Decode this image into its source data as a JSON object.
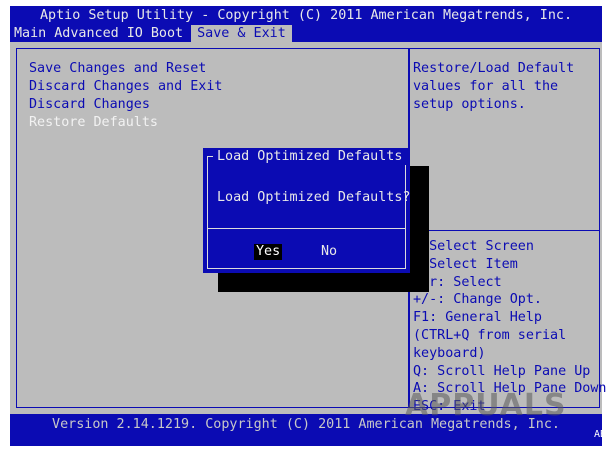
{
  "header": {
    "title": "Aptio Setup Utility - Copyright (C) 2011 American Megatrends, Inc.",
    "tabs": [
      {
        "label": "Main"
      },
      {
        "label": "Advanced"
      },
      {
        "label": "IO"
      },
      {
        "label": "Boot"
      },
      {
        "label": "Save & Exit"
      }
    ],
    "active_tab": "Save & Exit"
  },
  "menu": {
    "items": [
      {
        "label": "Save Changes and Reset"
      },
      {
        "label": "Discard Changes and Exit"
      },
      {
        "label": "Discard Changes"
      },
      {
        "label": "Restore Defaults"
      }
    ],
    "selected": "Restore Defaults"
  },
  "help": {
    "description": "Restore/Load Default\nvalues for all the\nsetup options.",
    "keys": ": Select Screen\n: Select Item\nter: Select\n+/-: Change Opt.\nF1: General Help\n(CTRL+Q from serial\nkeyboard)\nQ: Scroll Help Pane Up\nA: Scroll Help Pane Down\nESC: Exit"
  },
  "dialog": {
    "title": "Load Optimized Defaults",
    "message": "Load Optimized Defaults?",
    "yes_label": "Yes",
    "no_label": "No"
  },
  "footer": {
    "version": "Version 2.14.1219. Copyright (C) 2011 American Megatrends, Inc.",
    "corner_code": "AB"
  },
  "watermark": {
    "text": "APPUALS"
  },
  "colors": {
    "bios_blue": "#0b0bb3",
    "panel_gray": "#bcbcbc",
    "highlight_text": "#f2f2f2"
  }
}
